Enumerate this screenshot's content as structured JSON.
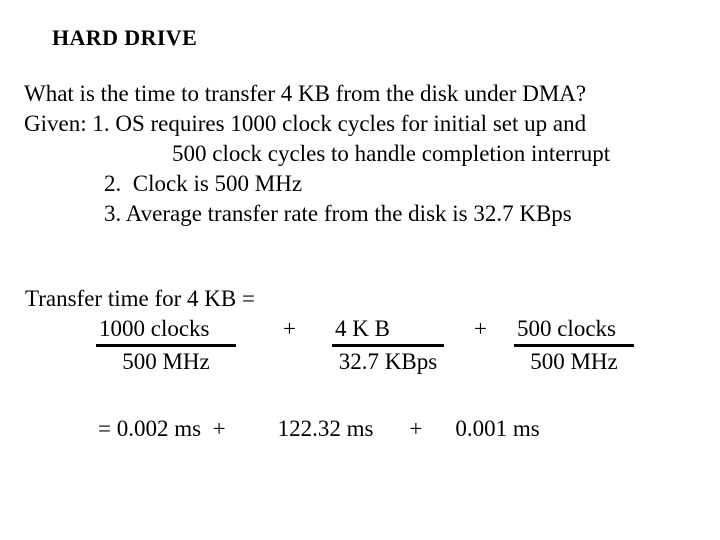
{
  "slide": {
    "title": "HARD DRIVE",
    "background_color": "#ffffff",
    "text_color": "#000000"
  },
  "statement": {
    "line1": "What is the time to transfer 4 KB from the disk under DMA?",
    "line2": "Given: 1. OS requires 1000 clock cycles for initial set up and",
    "line3": "500 clock cycles to handle completion interrupt",
    "line4": "2.  Clock is 500 MHz",
    "line5": "3. Average transfer rate from the disk is 32.7 KBps"
  },
  "equation": {
    "intro": "Transfer time for 4 KB =",
    "terms": [
      {
        "numerator": "1000 clocks",
        "denominator": "500 MHz"
      },
      {
        "numerator": "4 K B",
        "denominator": "32.7 KBps"
      },
      {
        "numerator": "500 clocks",
        "denominator": "500 MHz"
      }
    ],
    "operator_1": "+",
    "operator_2": "+"
  },
  "result": {
    "equals": "=",
    "term1": "0.002 ms",
    "operator_1": "+",
    "term2": "122.32 ms",
    "operator_2": "+",
    "term3": "0.001 ms"
  }
}
